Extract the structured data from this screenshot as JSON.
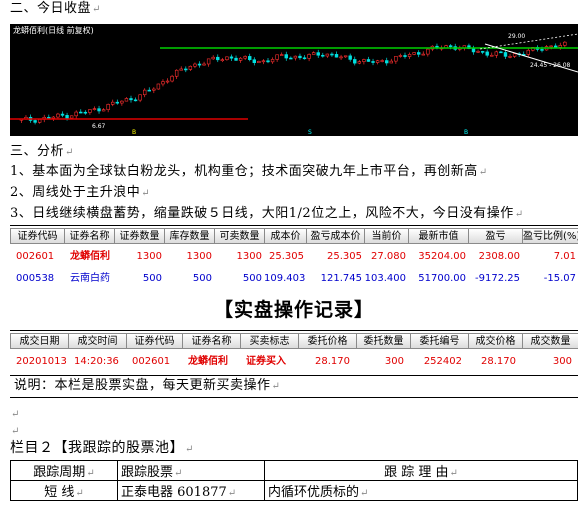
{
  "section2": {
    "title": "二、今日收盘"
  },
  "chart": {
    "title": "龙蟒佰利(日线 前复权)",
    "label_high": "29.00",
    "label_low": "6.67",
    "label_right": "24.45 - 26.08",
    "marker_left": "B",
    "marker_mid": "S",
    "marker_mid2": "B"
  },
  "chart_data": {
    "type": "candlestick",
    "title": "龙蟒佰利(日线 前复权)",
    "annotations": [
      "29.00",
      "6.67",
      "24.45 - 26.08"
    ],
    "approx_close_trend": [
      7.2,
      7.5,
      8.3,
      9.1,
      10.2,
      12.0,
      13.5,
      16.0,
      19.8,
      22.5,
      24.0,
      25.0,
      24.3,
      23.8,
      25.5,
      24.8,
      26.2,
      25.0,
      24.0,
      23.5,
      24.8,
      26.0,
      27.5,
      28.2,
      27.0,
      26.0,
      25.5,
      26.5,
      28.0,
      28.4
    ],
    "resistance_line": 24.4,
    "support_line": 7.4
  },
  "section3": {
    "title": "三、分析",
    "points": [
      "1、基本面为全球钛白粉龙头，机构重仓；技术面突破九年上市平台，再创新高",
      "2、周线处于主升浪中",
      "3、日线继续横盘蓄势，缩量跌破５日线，大阳1/2位之上，风险不大，今日没有操作"
    ]
  },
  "holdings": {
    "headers": [
      "证券代码",
      "证券名称",
      "证券数量",
      "库存数量",
      "可卖数量",
      "成本价",
      "盈亏成本价",
      "当前价",
      "最新市值",
      "盈亏",
      "盈亏比例(%)"
    ],
    "rows": [
      [
        "002601",
        "龙蟒佰利",
        "1300",
        "1300",
        "1300",
        "25.305",
        "25.305",
        "27.080",
        "35204.00",
        "2308.00",
        "7.01"
      ],
      [
        "000538",
        "云南白药",
        "500",
        "500",
        "500",
        "109.403",
        "121.745",
        "103.400",
        "51700.00",
        "-9172.25",
        "-15.07"
      ]
    ]
  },
  "record": {
    "title": "【实盘操作记录】",
    "headers": [
      "成交日期",
      "成交时间",
      "证券代码",
      "证券名称",
      "买卖标志",
      "委托价格",
      "委托数量",
      "委托编号",
      "成交价格",
      "成交数量"
    ],
    "rows": [
      [
        "20201013",
        "14:20:36",
        "002601",
        "龙蟒佰利",
        "证券买入",
        "28.170",
        "300",
        "252402",
        "28.170",
        "300"
      ]
    ],
    "note": "说明：本栏是股票实盘，每天更新买卖操作"
  },
  "pool": {
    "title": "栏目２【我跟踪的股票池】",
    "headers": [
      "跟踪周期",
      "跟踪股票",
      "跟 踪 理 由"
    ],
    "rows": [
      [
        "短 线",
        "正泰电器 601877",
        "内循环优质标的"
      ]
    ]
  },
  "colors": {
    "red": "#e00000",
    "blue": "#0000cc",
    "green": "#00d000"
  }
}
